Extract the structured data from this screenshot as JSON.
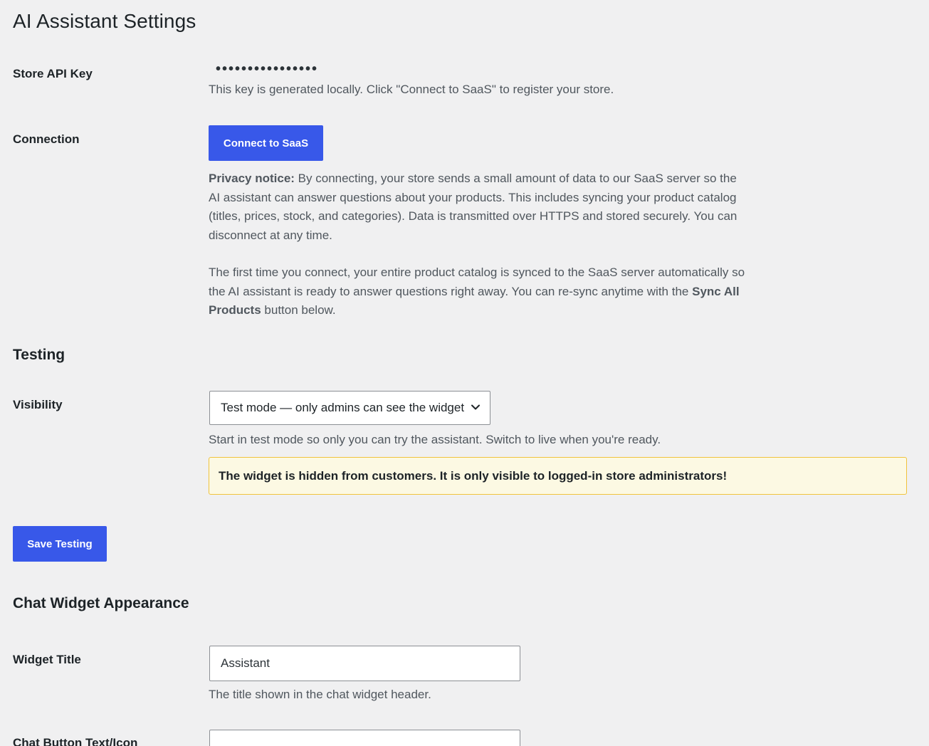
{
  "page": {
    "title": "AI Assistant Settings"
  },
  "api_key": {
    "label": "Store API Key",
    "masked_value": "••••••••••••••••",
    "description": "This key is generated locally. Click \"Connect to SaaS\" to register your store."
  },
  "connection": {
    "label": "Connection",
    "button_label": "Connect to SaaS",
    "privacy_lead": "Privacy notice:",
    "privacy_text": " By connecting, your store sends a small amount of data to our SaaS server so the AI assistant can answer questions about your products. This includes syncing your product catalog (titles, prices, stock, and categories). Data is transmitted over HTTPS and stored securely. You can disconnect at any time.",
    "sync_text_before": "The first time you connect, your entire product catalog is synced to the SaaS server automatically so the AI assistant is ready to answer questions right away. You can re-sync anytime with the ",
    "sync_bold": "Sync All Products",
    "sync_text_after": " button below."
  },
  "testing": {
    "heading": "Testing",
    "visibility_label": "Visibility",
    "visibility_selected": "Test mode — only admins can see the widget",
    "visibility_description": "Start in test mode so only you can try the assistant. Switch to live when you're ready.",
    "warning_text": "The widget is hidden from customers. It is only visible to logged-in store administrators!",
    "save_button_label": "Save Testing"
  },
  "appearance": {
    "heading": "Chat Widget Appearance",
    "widget_title_label": "Widget Title",
    "widget_title_value": "Assistant",
    "widget_title_description": "The title shown in the chat widget header.",
    "chat_button_label": "Chat Button Text/Icon"
  },
  "colors": {
    "accent": "#3858e9",
    "warning_bg": "#fcf9e3",
    "warning_border": "#f0c33c"
  },
  "icons": {
    "select_chevron": "chevron-down-icon"
  }
}
